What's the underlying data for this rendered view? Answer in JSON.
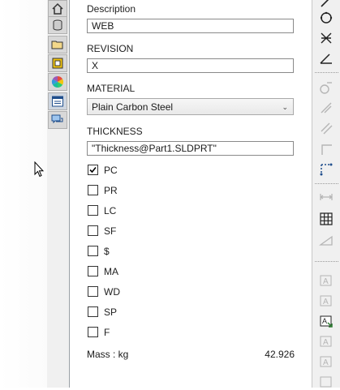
{
  "properties": {
    "description_label": "Description",
    "description_value": "WEB",
    "revision_label": "REVISION",
    "revision_value": "X",
    "material_label": "MATERIAL",
    "material_value": "Plain Carbon Steel",
    "thickness_label": "THICKNESS",
    "thickness_value": "\"Thickness@Part1.SLDPRT\""
  },
  "checkboxes": [
    {
      "label": "PC",
      "checked": true
    },
    {
      "label": "PR",
      "checked": false
    },
    {
      "label": "LC",
      "checked": false
    },
    {
      "label": "SF",
      "checked": false
    },
    {
      "label": "$",
      "checked": false
    },
    {
      "label": "MA",
      "checked": false
    },
    {
      "label": "WD",
      "checked": false
    },
    {
      "label": "SP",
      "checked": false
    },
    {
      "label": "F",
      "checked": false
    }
  ],
  "mass": {
    "label": "Mass : kg",
    "value": "42.926"
  },
  "left_tabs": [
    "home-icon",
    "cylinder-icon",
    "folder-icon",
    "sheet-icon",
    "color-wheel-icon",
    "property-list-icon",
    "comments-icon"
  ],
  "right_tools": [
    "line-icon",
    "circle-icon",
    "trim-icon",
    "angle-icon",
    "fillet-icon",
    "chamfer-icon",
    "offset-icon",
    "corner-icon",
    "dotted-line-icon",
    "dimension-icon",
    "grid-icon",
    "slope-icon",
    "text-icon",
    "text-edit-icon",
    "text-insert-icon",
    "text-format-icon",
    "text-more-icon"
  ],
  "colors": {
    "accent": "#2e7d32",
    "panel_bg": "#ffffff",
    "strip_bg": "#f0f0f0"
  }
}
